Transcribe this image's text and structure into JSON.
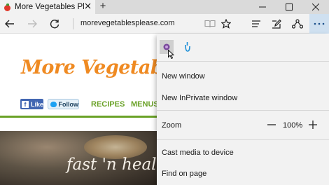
{
  "tab": {
    "title": "More Vegetables Please",
    "favicon": "tomato-favicon-icon",
    "close_icon": "close-icon"
  },
  "newtab_label": "+",
  "window_controls": [
    "minimize-icon",
    "maximize-icon",
    "close-icon"
  ],
  "nav": {
    "back_icon": "back-arrow-icon",
    "forward_icon": "forward-arrow-icon",
    "refresh_icon": "refresh-icon",
    "address": "morevegetablesplease.com",
    "reading_view_icon": "book-icon",
    "favorites_icon": "star-icon",
    "hub_icon": "hub-lines-icon",
    "note_icon": "pen-note-icon",
    "share_icon": "share-icon",
    "more_icon": "ellipsis-icon"
  },
  "page": {
    "logo": "More Vegetables P",
    "fb_like": "Like",
    "tw_follow": "Follow",
    "menu": [
      "RECIPES",
      "MENUS"
    ],
    "hero_text": "fast 'n healthy"
  },
  "panel": {
    "icons": [
      "new-window-icon",
      "mouse-icon"
    ],
    "items": {
      "new_window": "New window",
      "new_inprivate": "New InPrivate window",
      "zoom_label": "Zoom",
      "zoom_minus": "—",
      "zoom_value": "100%",
      "zoom_plus": "+",
      "cast": "Cast media to device",
      "find": "Find on page"
    }
  },
  "colors": {
    "logo_orange": "#ef8a22",
    "menu_green": "#6aa227",
    "facebook_blue": "#4267b2",
    "panel_bg": "#f2f2f2"
  }
}
